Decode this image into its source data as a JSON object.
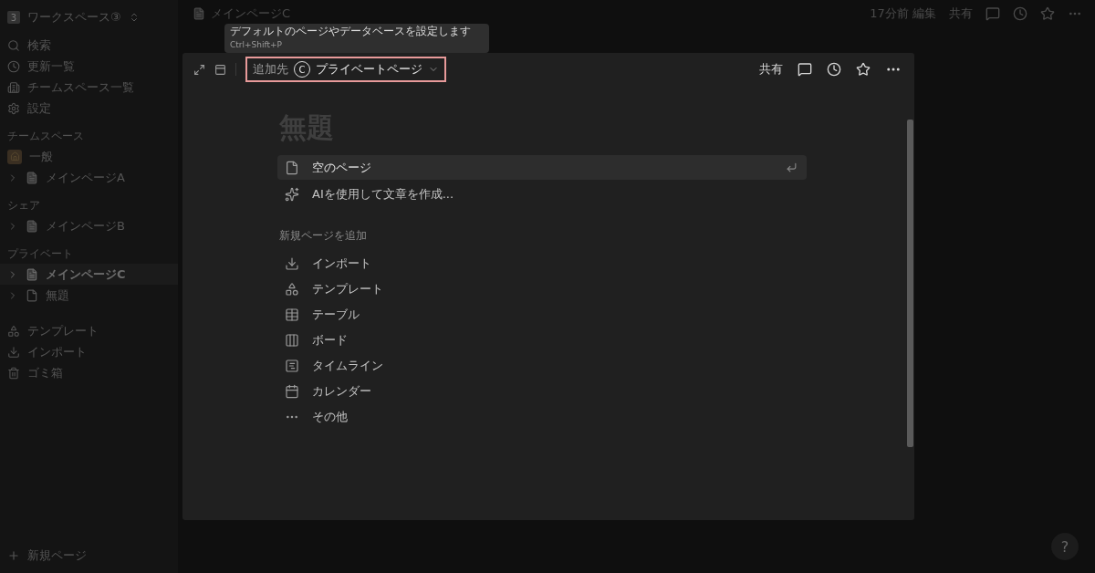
{
  "sidebar": {
    "workspace": {
      "badge": "3",
      "name": "ワークスペース③"
    },
    "nav": [
      {
        "kind": "search",
        "label": "検索"
      },
      {
        "kind": "clock",
        "label": "更新一覧"
      },
      {
        "kind": "building",
        "label": "チームスペース一覧"
      },
      {
        "kind": "settings",
        "label": "設定"
      }
    ],
    "sections": [
      {
        "title": "チームスペース",
        "items": [
          {
            "kind": "teamspace",
            "label": "一般",
            "selected": false
          },
          {
            "kind": "page",
            "label": "メインページA",
            "selected": false
          }
        ]
      },
      {
        "title": "シェア",
        "items": [
          {
            "kind": "page",
            "label": "メインページB",
            "selected": false
          }
        ]
      },
      {
        "title": "プライベート",
        "items": [
          {
            "kind": "page",
            "label": "メインページC",
            "selected": true
          },
          {
            "kind": "empty-page",
            "label": "無題",
            "selected": false
          }
        ]
      }
    ],
    "tools": [
      {
        "kind": "shapes",
        "label": "テンプレート"
      },
      {
        "kind": "download",
        "label": "インポート"
      },
      {
        "kind": "trash",
        "label": "ゴミ箱"
      }
    ],
    "new_page": "新規ページ"
  },
  "topbar": {
    "page_title": "メインページC",
    "edited": "17分前 編集",
    "share": "共有"
  },
  "tooltip": {
    "text": "デフォルトのページやデータベースを設定します",
    "shortcut": "Ctrl+Shift+P"
  },
  "modal": {
    "add_to_label": "追加先",
    "badge": "C",
    "destination": "プライベートページ",
    "share": "共有",
    "title": "無題",
    "options": [
      {
        "kind": "page",
        "label": "空のページ",
        "selected": true
      },
      {
        "kind": "sparkles",
        "label": "AIを使用して文章を作成...",
        "selected": false
      }
    ],
    "section_title": "新規ページを追加",
    "add_items": [
      {
        "kind": "download",
        "label": "インポート"
      },
      {
        "kind": "shapes",
        "label": "テンプレート"
      },
      {
        "kind": "table",
        "label": "テーブル"
      },
      {
        "kind": "board",
        "label": "ボード"
      },
      {
        "kind": "timeline",
        "label": "タイムライン"
      },
      {
        "kind": "calendar",
        "label": "カレンダー"
      },
      {
        "kind": "more",
        "label": "その他"
      }
    ]
  },
  "help": "?"
}
